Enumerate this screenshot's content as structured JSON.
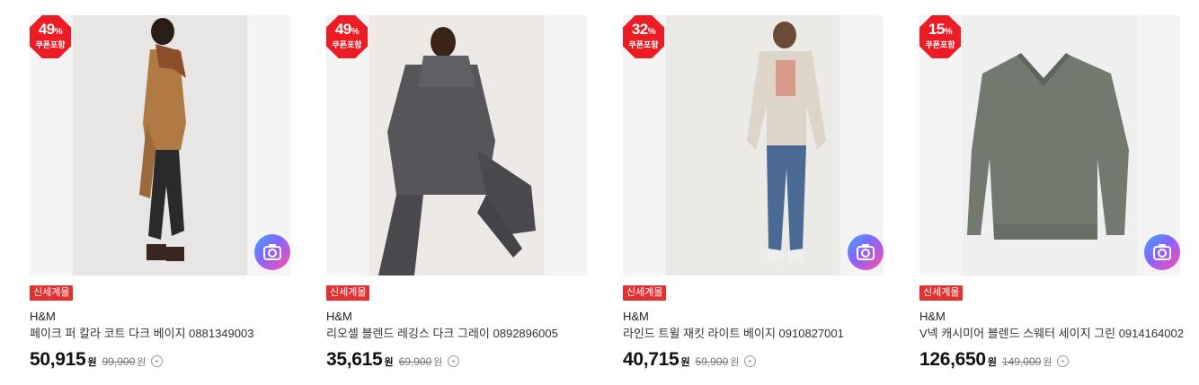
{
  "colors": {
    "badge": "#ed1c24",
    "tag": "#e53030",
    "camera_gradient": [
      "#3aa3ff",
      "#8a63ff",
      "#ff4fa3"
    ]
  },
  "products": [
    {
      "discount": "49",
      "discount_unit": "%",
      "coupon_label": "쿠폰포함",
      "tag": "신세계몰",
      "brand": "H&M",
      "name": "페이크 퍼 칼라 코트 다크 베이지 0881349003",
      "price": "50,915",
      "price_unit": "원",
      "original_price": "99,900",
      "original_unit": "원",
      "has_camera": true,
      "image": "woman-coat-photo"
    },
    {
      "discount": "49",
      "discount_unit": "%",
      "coupon_label": "쿠폰포함",
      "tag": "신세계몰",
      "brand": "H&M",
      "name": "리오셀 블렌드 레깅스 다크 그레이 0892896005",
      "price": "35,615",
      "price_unit": "원",
      "original_price": "69,900",
      "original_unit": "원",
      "has_camera": false,
      "image": "woman-leggings-photo"
    },
    {
      "discount": "32",
      "discount_unit": "%",
      "coupon_label": "쿠폰포함",
      "tag": "신세계몰",
      "brand": "H&M",
      "name": "라인드 트윌 재킷 라이트 베이지 0910827001",
      "price": "40,715",
      "price_unit": "원",
      "original_price": "59,900",
      "original_unit": "원",
      "has_camera": true,
      "image": "woman-jacket-photo"
    },
    {
      "discount": "15",
      "discount_unit": "%",
      "coupon_label": "쿠폰포함",
      "tag": "신세계몰",
      "brand": "H&M",
      "name": "V넥 캐시미어 블렌드 스웨터 세이지 그린 0914164002",
      "price": "126,650",
      "price_unit": "원",
      "original_price": "149,000",
      "original_unit": "원",
      "has_camera": true,
      "image": "sweater-photo"
    }
  ]
}
